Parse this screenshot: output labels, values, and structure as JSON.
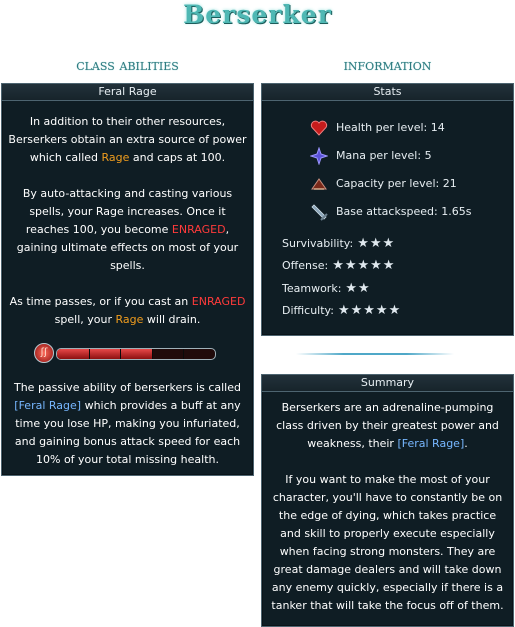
{
  "page": {
    "title": "Berserker"
  },
  "class_abilities": {
    "heading": "class abilities",
    "panel_title": "Feral Rage",
    "para1": {
      "pre": "In addition to their other resources, Berserkers obtain an extra source of power which called ",
      "rage": "Rage",
      "post": " and caps at 100."
    },
    "para2": {
      "pre": "By auto-attacking and casting various spells, your Rage increases. Once it reaches 100, you become ",
      "enraged": "ENRAGED",
      "post": ", gaining ultimate effects on most of your spells."
    },
    "para3": {
      "pre": "As time passes, or if you cast an ",
      "enraged": "ENRAGED",
      "mid": " spell, your ",
      "rage": "Rage",
      "post": " will drain."
    },
    "rage_bar": {
      "icon": "rage-claw-icon",
      "fill_fraction": 0.6,
      "segments": 5
    },
    "para4": {
      "pre": "The passive ability of berserkers is called ",
      "link": "[Feral Rage]",
      "post": " which provides a buff at any time you lose HP, making you infuriated, and gaining bonus attack speed for each 10% of your total missing health."
    }
  },
  "information": {
    "heading": "information",
    "stats_title": "Stats",
    "stats": [
      {
        "icon": "heart-icon",
        "label": "Health per level:",
        "value": "14"
      },
      {
        "icon": "mana-icon",
        "label": "Mana per level:",
        "value": "5"
      },
      {
        "icon": "capacity-icon",
        "label": "Capacity per level:",
        "value": "21"
      },
      {
        "icon": "sword-icon",
        "label": "Base attackspeed:",
        "value": "1.65s"
      }
    ],
    "ratings": [
      {
        "label": "Survivability:",
        "stars": 3,
        "star_text": "★★★"
      },
      {
        "label": "Offense:",
        "stars": 5,
        "star_text": "★★★★★"
      },
      {
        "label": "Teamwork:",
        "stars": 2,
        "star_text": "★★"
      },
      {
        "label": "Difficulty:",
        "stars": 5,
        "star_text": "★★★★★"
      }
    ]
  },
  "summary": {
    "panel_title": "Summary",
    "para1": {
      "pre": "Berserkers are an adrenaline-pumping class driven by their greatest power and weakness, their ",
      "link": "[Feral Rage]",
      "post": "."
    },
    "para2": "If you want to make the most of your character, you'll have to constantly be on the edge of dying, which takes practice and skill to properly execute especially when facing strong monsters. They are great damage dealers and will take down any enemy quickly, especially if there is a tanker that will take the focus off of them."
  },
  "colors": {
    "accent": "#4fb8b4",
    "rage": "#f09d1e",
    "enraged": "#ff3b3b",
    "link": "#77b7ff",
    "panel_bg": "#0f1d24"
  }
}
